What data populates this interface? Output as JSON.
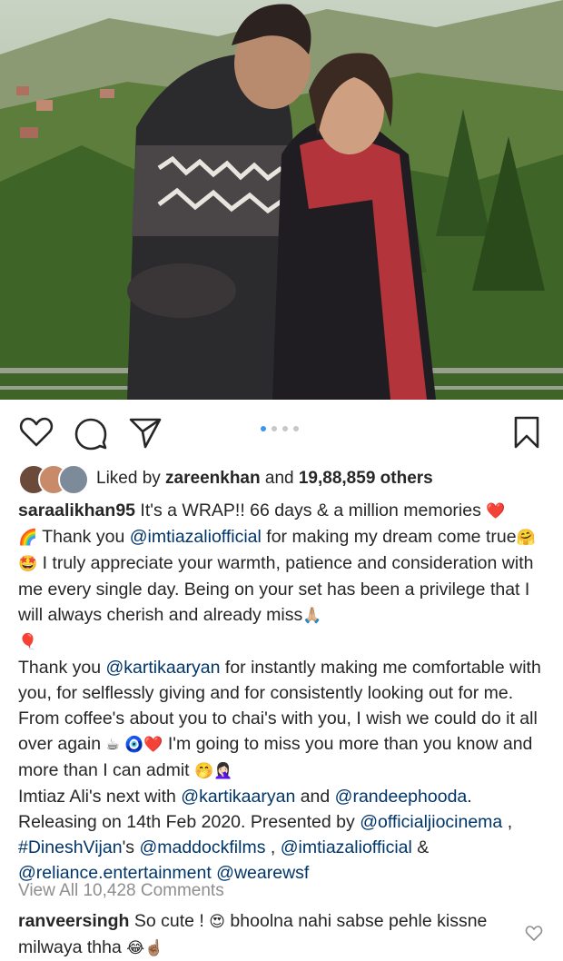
{
  "post": {
    "photo_icon": "couple-mountain-photo",
    "carousel": {
      "count": 4,
      "active_index": 0
    }
  },
  "actions": {
    "like_icon": "heart-outline-icon",
    "comment_icon": "comment-bubble-icon",
    "share_icon": "paper-plane-icon",
    "save_icon": "bookmark-icon"
  },
  "likes": {
    "prefix": "Liked by ",
    "user": "zareenkhan",
    "middle": " and ",
    "others": "19,88,859 others"
  },
  "caption": {
    "username": "saraalikhan95",
    "p1_a": " It's a WRAP!! 66 days & a million memories ",
    "p1_e1": "❤️",
    "p1_e2": "🌈",
    "p1_b": " Thank you ",
    "p1_m1": "@imtiazaliofficial",
    "p1_c": " for making my dream come true",
    "p1_e3": "🤗🤩",
    "p1_d": " I truly appreciate your warmth, patience and consideration with me every single day. Being on your set has been a privilege that I will always cherish and already miss",
    "p1_e4": "🙏🏼",
    "p1_e5": "🎈",
    "p2_a": "Thank you ",
    "p2_m1": "@kartikaaryan",
    "p2_b": " for instantly making me comfortable with you, for selflessly giving and for consistently looking out for me. From coffee's about you to chai's with you, I wish we could do it all over again ",
    "p2_e1": "☕ 🧿❤️",
    "p2_c": " I'm going to miss you more than you know and more than I can admit ",
    "p2_e2": "🤭🤦🏻‍♀️",
    "p3_a": "Imtiaz Ali's next with ",
    "p3_m1": "@kartikaaryan",
    "p3_b": " and ",
    "p3_m2": "@randeephooda",
    "p3_c": ". Releasing on 14th Feb 2020. Presented by ",
    "p3_m3": "@officialjiocinema",
    "p3_d": " , ",
    "p3_m4": "#DineshVijan",
    "p3_e": "'s ",
    "p3_m5": "@maddockfilms",
    "p3_f": " , ",
    "p3_m6": "@imtiazaliofficial",
    "p3_g": " & ",
    "p3_m7": "@reliance.entertainment",
    "p3_h": " ",
    "p3_m8": "@wearewsf"
  },
  "view_all": "View All 10,428 Comments",
  "comment": {
    "username": "ranveersingh",
    "text_a": " So cute ! ",
    "e1": "😍",
    "text_b": " bhoolna nahi sabse pehle kissne milwaya thha ",
    "e2": "😂☝🏽",
    "like_icon": "small-heart-icon"
  },
  "colors": {
    "accent": "#3897f0",
    "mention": "#003569",
    "muted": "#8e8e8e"
  }
}
